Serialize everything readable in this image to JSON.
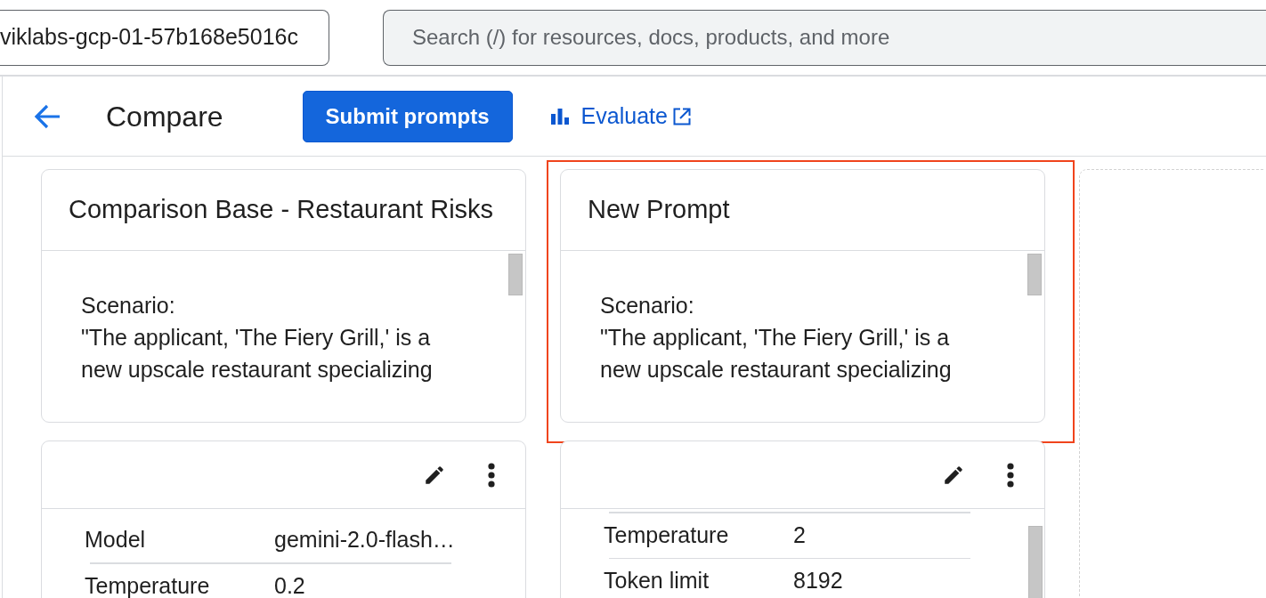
{
  "top_bar": {
    "project_picker": {
      "value": "viklabs-gcp-01-57b168e5016c"
    },
    "search": {
      "placeholder": "Search (/) for resources, docs, products, and more"
    }
  },
  "toolbar": {
    "title": "Compare",
    "submit_button": "Submit prompts",
    "evaluate_link": "Evaluate"
  },
  "columns": [
    {
      "highlighted": false,
      "prompt_card": {
        "title": "Comparison Base - Restaurant Risks",
        "text_lines": [
          "Scenario:",
          "\"The applicant, 'The Fiery Grill,' is a",
          "new upscale restaurant specializing"
        ]
      },
      "settings_card": {
        "scrolled": false,
        "rows": [
          {
            "label": "Model",
            "value": "gemini-2.0-flash…"
          },
          {
            "label": "Temperature",
            "value": "0.2"
          }
        ]
      }
    },
    {
      "highlighted": true,
      "prompt_card": {
        "title": "New Prompt",
        "text_lines": [
          "Scenario:",
          "\"The applicant, 'The Fiery Grill,' is a",
          "new upscale restaurant specializing"
        ]
      },
      "settings_card": {
        "scrolled": true,
        "rows": [
          {
            "label": "Temperature",
            "value": "2"
          },
          {
            "label": "Token limit",
            "value": "8192"
          }
        ]
      }
    }
  ]
}
